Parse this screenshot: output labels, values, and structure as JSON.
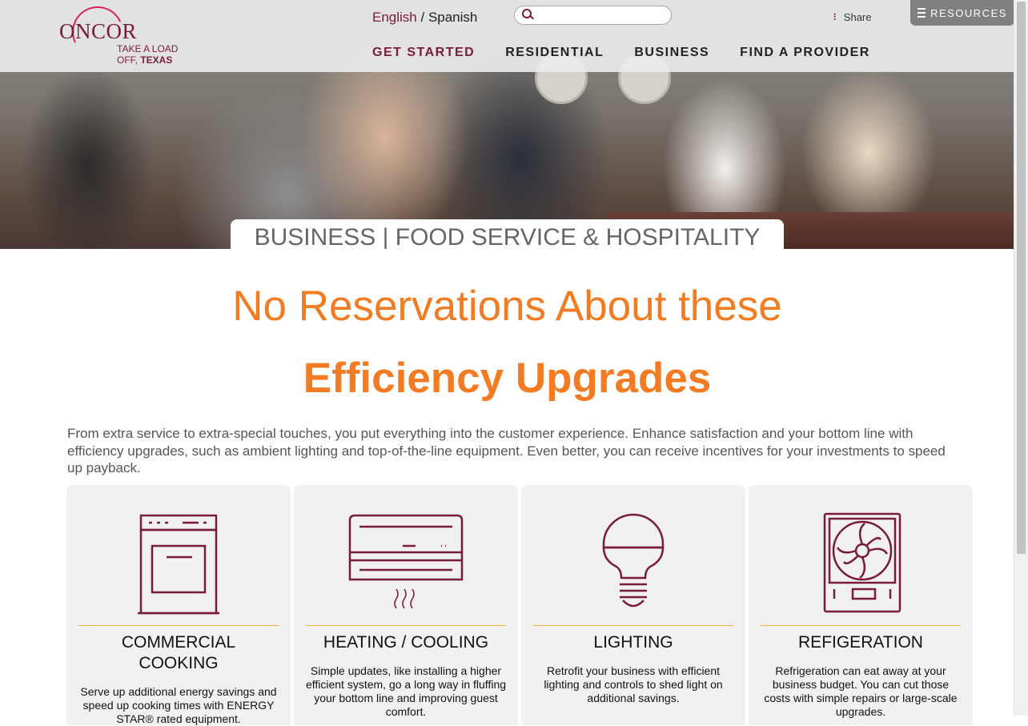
{
  "header": {
    "logo": {
      "brand": "ONCOR",
      "tagline_1": "TAKE A LOAD",
      "tagline_2a": "OFF,",
      "tagline_2b": "TEXAS"
    },
    "language": {
      "active": "English",
      "separator": " / ",
      "other": "Spanish"
    },
    "search": {
      "placeholder": "",
      "value": ""
    },
    "share_label": "Share",
    "resources_label": "RESOURCES",
    "nav": [
      "GET STARTED",
      "RESIDENTIAL",
      "BUSINESS",
      "FIND A PROVIDER"
    ]
  },
  "hero": {
    "title": "BUSINESS | FOOD SERVICE & HOSPITALITY"
  },
  "main": {
    "headline_1": "No Reservations About these",
    "headline_2": "Efficiency Upgrades",
    "intro": "From extra service to extra-special touches, you put everything into the customer experience. Enhance satisfaction and your bottom line with efficiency upgrades, such as ambient lighting and top-of-the-line equipment. Even better, you can receive incentives for your investments to speed up payback.",
    "cards": [
      {
        "icon": "stove-icon",
        "title": "COMMERCIAL COOKING",
        "text": "Serve up additional energy savings and speed up cooking times with ENERGY STAR® rated equipment."
      },
      {
        "icon": "air-conditioner-icon",
        "title": "HEATING / COOLING",
        "text": "Simple updates, like installing a higher efficient system, go a long way in fluffing your bottom line and improving guest comfort."
      },
      {
        "icon": "light-bulb-icon",
        "title": "LIGHTING",
        "text": "Retrofit your business with efficient lighting and controls to shed light on additional savings."
      },
      {
        "icon": "refrigeration-fan-icon",
        "title": "REFIGERATION",
        "text": "Refrigeration can eat away at your business budget. You can cut those costs with simple repairs or large-scale upgrades."
      }
    ]
  },
  "colors": {
    "brand": "#7a1a3e",
    "accent": "#f37b21",
    "rule": "#f0b040"
  }
}
